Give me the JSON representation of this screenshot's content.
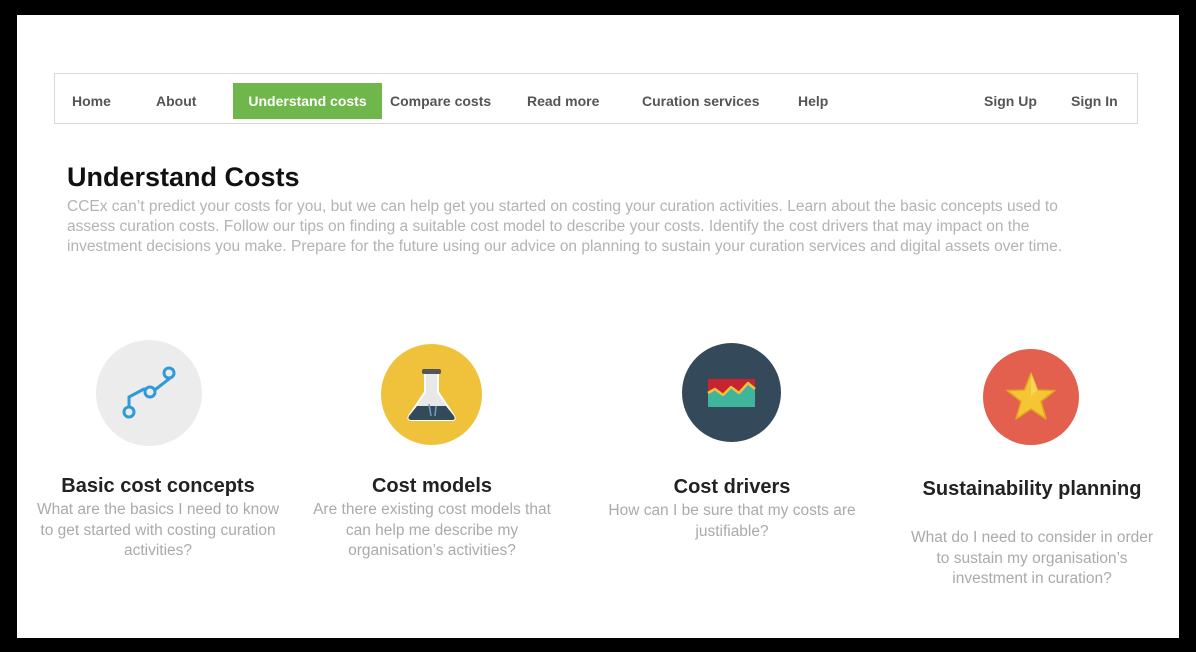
{
  "nav": {
    "home": "Home",
    "about": "About",
    "understand_costs": "Understand costs",
    "compare_costs": "Compare costs",
    "read_more": "Read more",
    "curation_services": "Curation services",
    "help": "Help",
    "sign_up": "Sign Up",
    "sign_in": "Sign In",
    "active_color": "#6fb74a"
  },
  "page": {
    "title": "Understand Costs",
    "intro": "CCEx can’t predict your costs for you, but we can help get you started on costing your curation activities. Learn about the basic concepts used to assess curation costs. Follow our tips on finding a suitable cost model to describe your costs. Identify the cost drivers that may impact on the investment decisions you make. Prepare for the future using our advice on planning to sustain your curation services and digital assets over time."
  },
  "cards": [
    {
      "icon": "path-nodes-icon",
      "circle_color": "#ececec",
      "title": "Basic cost concepts",
      "description": "What are the basics I need to know to get started with costing curation activities?"
    },
    {
      "icon": "flask-icon",
      "circle_color": "#f0c23b",
      "title": "Cost models",
      "description": "Are there existing cost models that can help me describe my organisation’s activities?"
    },
    {
      "icon": "line-chart-icon",
      "circle_color": "#34495a",
      "title": "Cost drivers",
      "description": "How can I be sure that my costs are justifiable?"
    },
    {
      "icon": "star-icon",
      "circle_color": "#e3604f",
      "title": "Sustainability planning",
      "description": "What do I need to consider in order to sustain my organisation’s investment in curation?"
    }
  ]
}
